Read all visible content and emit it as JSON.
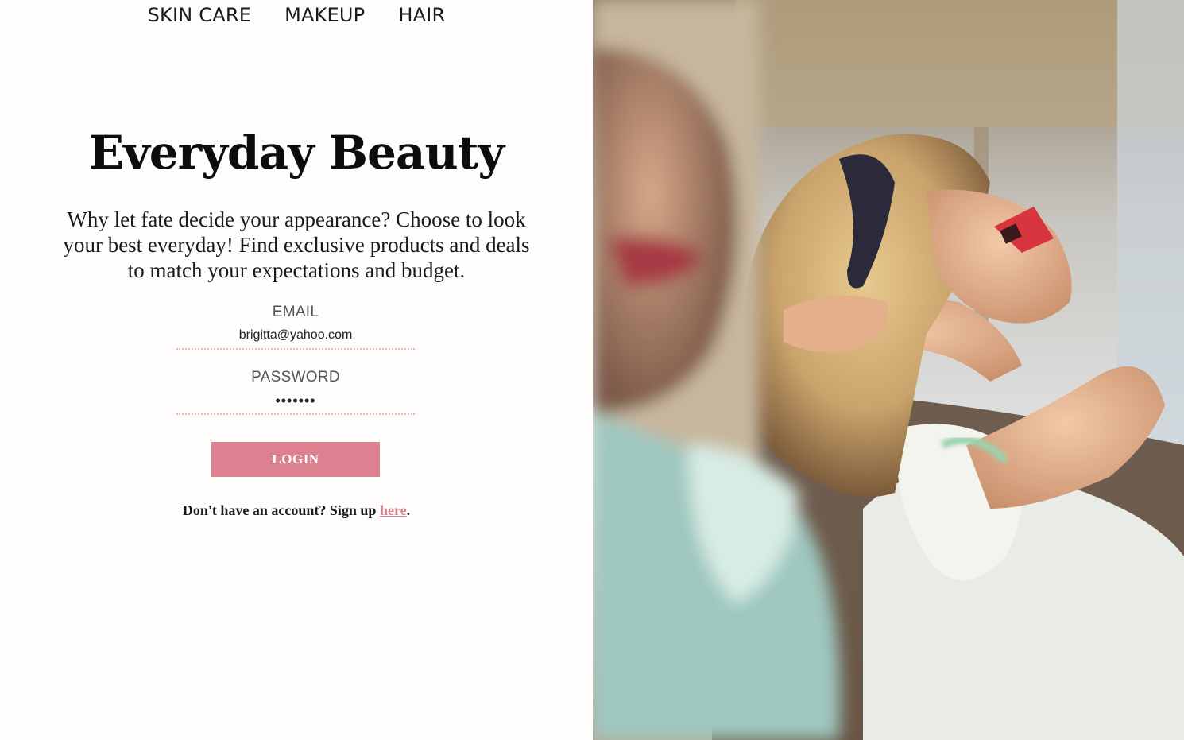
{
  "nav": {
    "items": [
      {
        "label": "SKIN CARE"
      },
      {
        "label": "MAKEUP"
      },
      {
        "label": "HAIR"
      }
    ]
  },
  "hero": {
    "title": "Everyday Beauty",
    "tagline": "Why let fate decide your appearance? Choose to look your best everyday! Find exclusive products and deals to match your expectations and budget."
  },
  "form": {
    "email_label": "EMAIL",
    "email_value": "brigitta@yahoo.com",
    "password_label": "PASSWORD",
    "password_value": "•••••••",
    "login_label": "LOGIN"
  },
  "signup": {
    "prefix": "Don't have an account? Sign up ",
    "link_label": "here",
    "suffix": "."
  },
  "colors": {
    "accent": "#dd8190",
    "link": "#d97f8f",
    "background": "#fffcfc",
    "underline": "#e8b4bc"
  }
}
